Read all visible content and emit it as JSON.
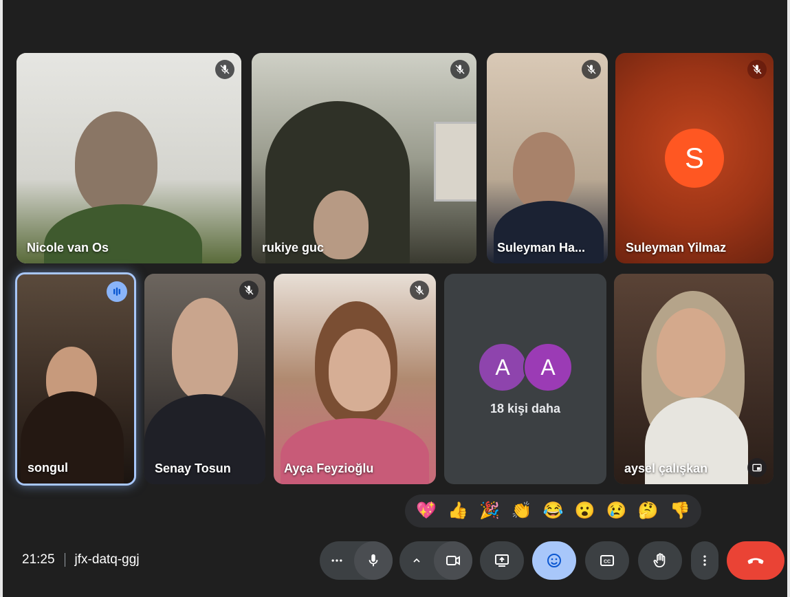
{
  "participants": [
    {
      "name": "Nicole van Os",
      "muted": true
    },
    {
      "name": "rukiye guc",
      "muted": true
    },
    {
      "name": "Suleyman Ha...",
      "muted": true
    },
    {
      "name": "Suleyman Yilmaz",
      "muted": true,
      "avatar_letter": "S",
      "avatar_color": "#ff5722"
    },
    {
      "name": "songul",
      "speaking": true
    },
    {
      "name": "Senay Tosun",
      "muted": true
    },
    {
      "name": "Ayça Feyzioğlu",
      "muted": true
    },
    {
      "name": "aysel çalışkan"
    }
  ],
  "more_people": {
    "avatars": [
      "A",
      "A"
    ],
    "label": "18 kişi daha"
  },
  "reactions": [
    "💖",
    "👍",
    "🎉",
    "👏",
    "😂",
    "😮",
    "😢",
    "🤔",
    "👎"
  ],
  "meeting": {
    "time": "21:25",
    "code": "jfx-datq-ggj"
  },
  "colors": {
    "background": "#1f1f1f",
    "tile": "#3c4043",
    "active_button": "#a8c7fa",
    "end_call": "#ea4335",
    "speaking_ring": "#8ab4f8"
  },
  "icons": [
    "mic-off-icon",
    "speaking-indicator-icon",
    "more-horiz-icon",
    "mic-icon",
    "chevron-up-icon",
    "camera-icon",
    "present-screen-icon",
    "emoji-icon",
    "captions-icon",
    "raise-hand-icon",
    "more-vert-icon",
    "end-call-icon",
    "pip-icon"
  ]
}
